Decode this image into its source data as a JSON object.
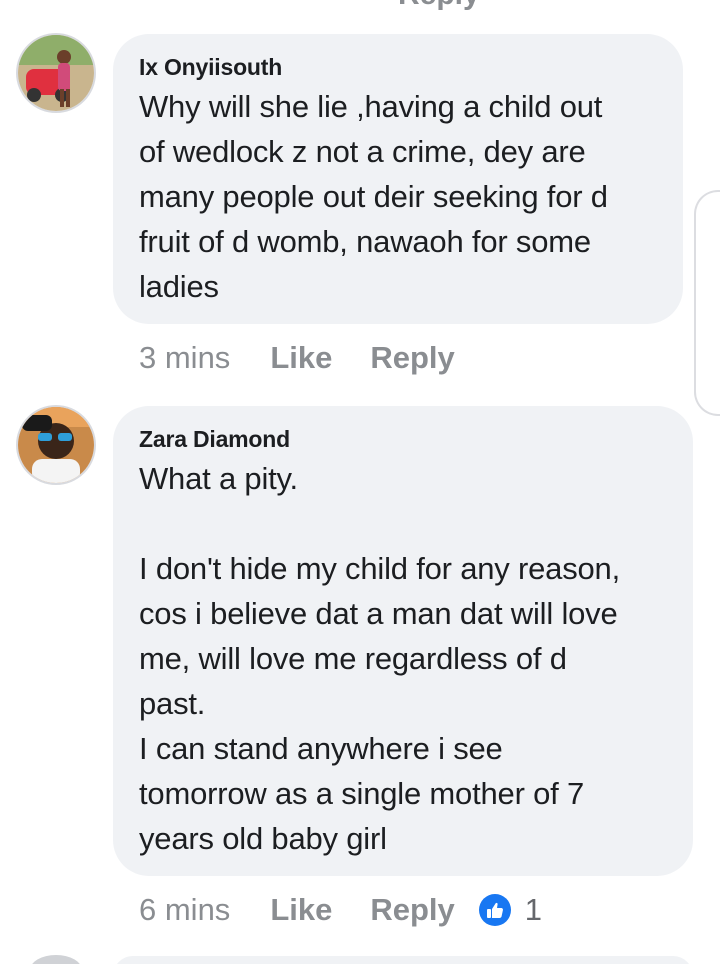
{
  "top_partial_label": "Reply",
  "comments": [
    {
      "author": "Ix Onyiisouth",
      "text": "Why will she lie ,having a child out\nof wedlock z not a crime, dey are\nmany people out deir seeking for d\nfruit of d womb, nawaoh for some\nladies",
      "time": "3 mins",
      "like_label": "Like",
      "reply_label": "Reply"
    },
    {
      "author": "Zara Diamond",
      "text": "What a pity.\n\nI don't hide my child for any reason,\ncos i believe dat a man dat will love\nme, will love me regardless of d\npast.\nI can stand anywhere i see\ntomorrow as a single mother of 7\nyears old baby girl",
      "time": "6 mins",
      "like_label": "Like",
      "reply_label": "Reply",
      "reaction_icon": "thumbs-up-icon",
      "reaction_count": "1"
    }
  ],
  "colors": {
    "bubble": "#f0f2f5",
    "meta_text": "#8a8d91",
    "like_blue": "#1877f2"
  }
}
